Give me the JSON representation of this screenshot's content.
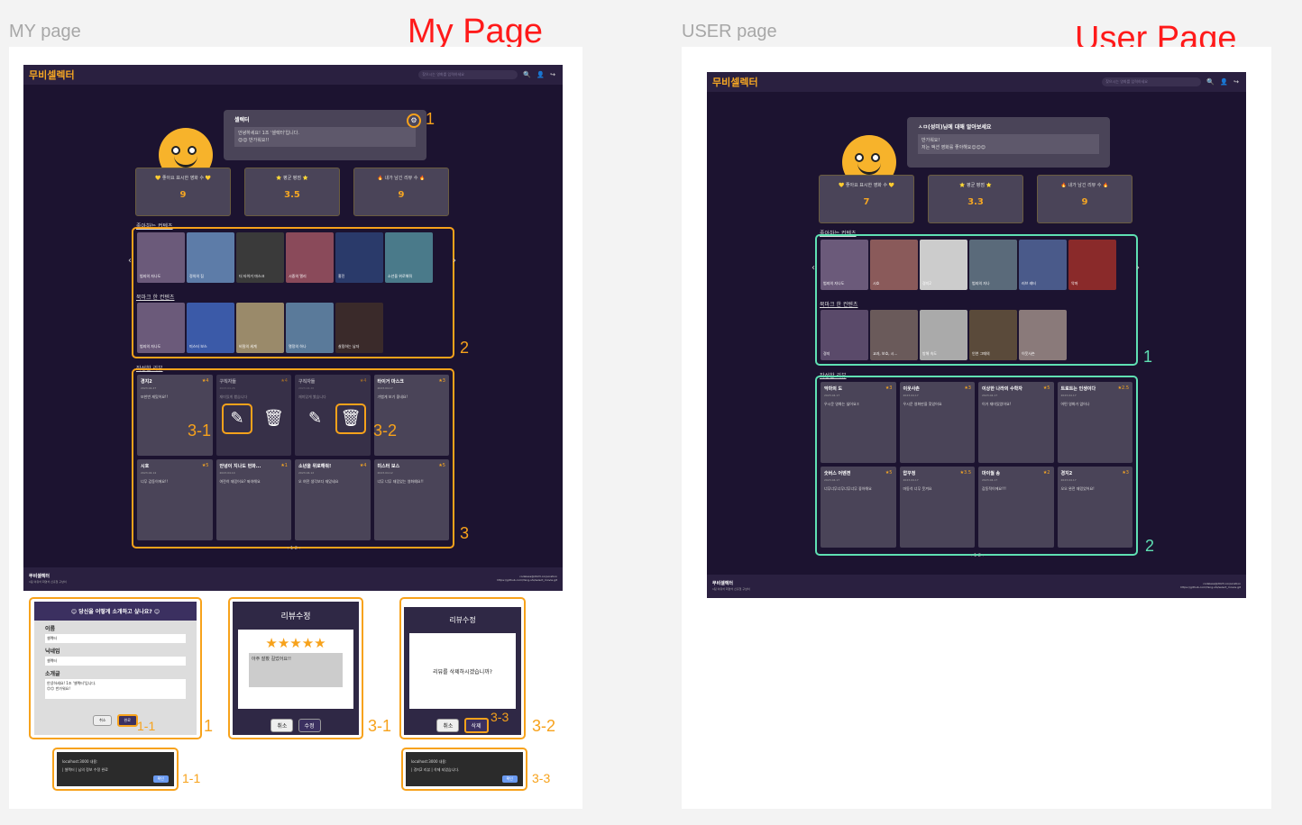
{
  "left": {
    "label": "MY page",
    "heading": "My Page",
    "logo": "무비셀렉터",
    "search_placeholder": "찾으시는 영화를 입력하세요",
    "profile": {
      "name": "셀렉터",
      "bio_line1": "안녕하세요! 1조 '셀렉터'입니다.",
      "bio_line2": "😊😊 반가워요!!"
    },
    "stats": [
      {
        "label": "💛 좋아요 표시한 영화 수 💛",
        "value": "9"
      },
      {
        "label": "⭐ 평균 평점 ⭐",
        "value": "3.5"
      },
      {
        "label": "🔥 내가 남긴 리뷰 수 🔥",
        "value": "9"
      }
    ],
    "liked_title": "좋아하는 컨텐츠",
    "liked": [
      "범죄의 자나도",
      "정의의 집",
      "더 타이거 마스크",
      "시중의 엘리",
      "홍진",
      "소년을 위로해줘"
    ],
    "bookmark_title": "북마크 한 컨텐츠",
    "bookmarks": [
      "범죄의 자나도",
      "미스터 보스",
      "비밀의 세계",
      "열정의 하나",
      "살림하는 남자"
    ],
    "review_title": "작성한 리뷰",
    "reviews": [
      {
        "title": "경지2",
        "star": "★4",
        "date": "2023.04.27",
        "body": "또한번 재밌어요!!"
      },
      {
        "title": "구직자들",
        "star": "★4",
        "date": "2023.04.26",
        "body": "재미있게 봤습니다"
      },
      {
        "title": "구직자들",
        "star": "★4",
        "date": "2023.04.26",
        "body": "재미있게 봤습니다"
      },
      {
        "title": "타이거 마스크",
        "star": "★3",
        "date": "2023.04.17",
        "body": "가볍게 보기 좋네요!"
      },
      {
        "title": "시호",
        "star": "★5",
        "date": "2023.04.14",
        "body": "너무 감동이에요!!"
      },
      {
        "title": "안녕이 지나도 번화...",
        "star": "★1",
        "date": "2023.04.14",
        "body": "여전히 재밌어요? 봐야해요"
      },
      {
        "title": "소년을 위로해줘!",
        "star": "★4",
        "date": "2023.04.12",
        "body": "오 여전 생각보다 재밌네요"
      },
      {
        "title": "미스터 보스",
        "star": "★5",
        "date": "2023.04.12",
        "body": "너무 너무 재밌었는 영화예요!!"
      }
    ],
    "pagination": "‹  1  2  ›",
    "footer": {
      "logo": "무비셀렉터",
      "sub": "1팀 이유석 최영석 신홍철 구냥이",
      "right1": "codeless@2023.corporation",
      "right2": "https://github.com/Yang-shi/select_movie.git"
    },
    "marks": {
      "m1": "1",
      "m2": "2",
      "m3": "3",
      "m31": "3-1",
      "m32": "3-2"
    }
  },
  "modals": {
    "intro": {
      "title": "😊 당신을 어떻게 소개하고 싶나요? 😊",
      "name_label": "이름",
      "name_val": "셀렉터",
      "nick_label": "닉네임",
      "nick_val": "셀렉터",
      "bio_label": "소개글",
      "bio_val1": "안녕하세요! 1조 '셀렉터'입니다.",
      "bio_val2": "😊😊 반가워요!",
      "cancel": "취소",
      "ok": "완료",
      "mark": "1",
      "mark_ok": "1-1"
    },
    "edit": {
      "title": "리뷰수정",
      "stars": "★★★★★",
      "text": "아주 잘봤 길었어요!!",
      "cancel": "취소",
      "ok": "수정",
      "mark": "3-1"
    },
    "del": {
      "title": "리뷰수정",
      "msg": "리뷰를 삭제하시겠습니까?",
      "cancel": "취소",
      "ok": "삭제",
      "mark": "3-2",
      "mark_ok": "3-3"
    },
    "alert1": {
      "host": "localhost:3000 내용:",
      "msg": "| 셀렉터 | 님의 정보 수정 완료",
      "ok": "확인",
      "mark": "1-1"
    },
    "alert2": {
      "host": "localhost:3000 내용:",
      "msg": "| 경지2 리뷰 | 삭제 되었습니다.",
      "ok": "확인",
      "mark": "3-3"
    }
  },
  "right": {
    "label": "USER page",
    "heading": "User Page",
    "logo": "무비셀렉터",
    "search_placeholder": "찾으시는 영화를 입력하세요",
    "profile": {
      "name": "ㅅㅁ(성미)님에 대해 알아보세요",
      "bio_line1": "반가워요!",
      "bio_line2": "저는 액션 영화를 좋아해요😊😊😊"
    },
    "stats": [
      {
        "label": "💛 좋아요 표시한 영화 수 💛",
        "value": "7"
      },
      {
        "label": "⭐ 평균 평점 ⭐",
        "value": "3.3"
      },
      {
        "label": "🔥 내가 남긴 리뷰 수 🔥",
        "value": "9"
      }
    ],
    "liked_title": "좋아하는 컨텐츠",
    "liked": [
      "범죄의 자나도",
      "시호",
      "경지2",
      "범죄의 자나",
      "러브 레터",
      "악마"
    ],
    "bookmark_title": "북마크 한 컨텐츠",
    "bookmarks": [
      "경지",
      "교과, 보호, 시...",
      "방해 속도",
      "인연 그때의",
      "이웃사촌"
    ],
    "review_title": "작성한 리뷰",
    "reviews": [
      {
        "title": "악마의 도",
        "star": "★3",
        "date": "2023.04.17",
        "body": "우시운 영화는 싫어요ㅎ"
      },
      {
        "title": "이웃사촌",
        "star": "★3",
        "date": "2023.04.17",
        "body": "우시운 영화만을 찾았어요"
      },
      {
        "title": "이상한 나라의 수학자",
        "star": "★5",
        "date": "2023.04.17",
        "body": "이거 재미있었어요!"
      },
      {
        "title": "트로트는 인생이다",
        "star": "★2.5",
        "date": "2023.04.17",
        "body": "어떤 영화가 없어나"
      },
      {
        "title": "숫버스 어벤젼",
        "star": "★5",
        "date": "2023.04.17",
        "body": "너무너무너무너무너무 좋아해요"
      },
      {
        "title": "압꾸정",
        "star": "★3.5",
        "date": "2023.04.17",
        "body": "마동석 너무 웃겨요"
      },
      {
        "title": "마이월 송",
        "star": "★2",
        "date": "2023.04.17",
        "body": "감동적이에요!!!"
      },
      {
        "title": "경지2",
        "star": "★3",
        "date": "2023.04.17",
        "body": "오오 완전 재밌었어요!"
      }
    ],
    "pagination": "‹  1  2  ›",
    "footer": {
      "logo": "무비셀렉터",
      "sub": "1팀 이유석 최영석 신홍철 구냥이",
      "right1": "codeless@2023.corporation",
      "right2": "https://github.com/Yang-shi/select_movie.git"
    },
    "marks": {
      "m1": "1",
      "m2": "2"
    }
  },
  "colors": {
    "accent_orange": "#f7a21b",
    "accent_green": "#5fe0b3",
    "site_bg": "#1c1330",
    "heading_red": "#ff1a1a"
  }
}
